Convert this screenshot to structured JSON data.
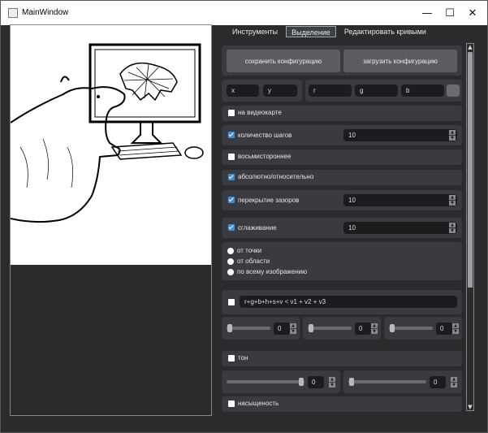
{
  "window": {
    "title": "MainWindow",
    "minimize": "—",
    "maximize": "☐",
    "close": "✕"
  },
  "tabs": [
    {
      "label": "Инструменты"
    },
    {
      "label": "Выделение"
    },
    {
      "label": "Редактировать кривыми"
    }
  ],
  "config": {
    "save": "сохранить конфигурацию",
    "load": "загрузить конфигурацию"
  },
  "fields": {
    "x": "x",
    "y": "y",
    "r": "r",
    "g": "g",
    "b": "b"
  },
  "options": {
    "gpu": "на видеокарте",
    "steps": "количество шагов",
    "steps_value": "10",
    "eight_way": "восьмистороннее",
    "absolute_relative": "абсолютно/относительно",
    "gap_overlap": "перекрытие зазоров",
    "gap_value": "10",
    "smoothing": "сглаживание",
    "smoothing_value": "10",
    "from_point": "от точки",
    "from_area": "от области",
    "whole_image": "по всему изображению",
    "formula": "r+g+b+h+s+v < v1 + v2 + v3",
    "v1": "0",
    "v2": "0",
    "v3": "0",
    "tone": "тон",
    "tone_a": "0",
    "tone_b": "0",
    "saturation": "насыщеность"
  },
  "colors": {
    "accent": "#3d8fd1",
    "panel": "#3a3b40",
    "field": "#1c1c1e"
  },
  "scrollbar": {
    "up": "▲",
    "down": "▼",
    "position": 0.0
  }
}
